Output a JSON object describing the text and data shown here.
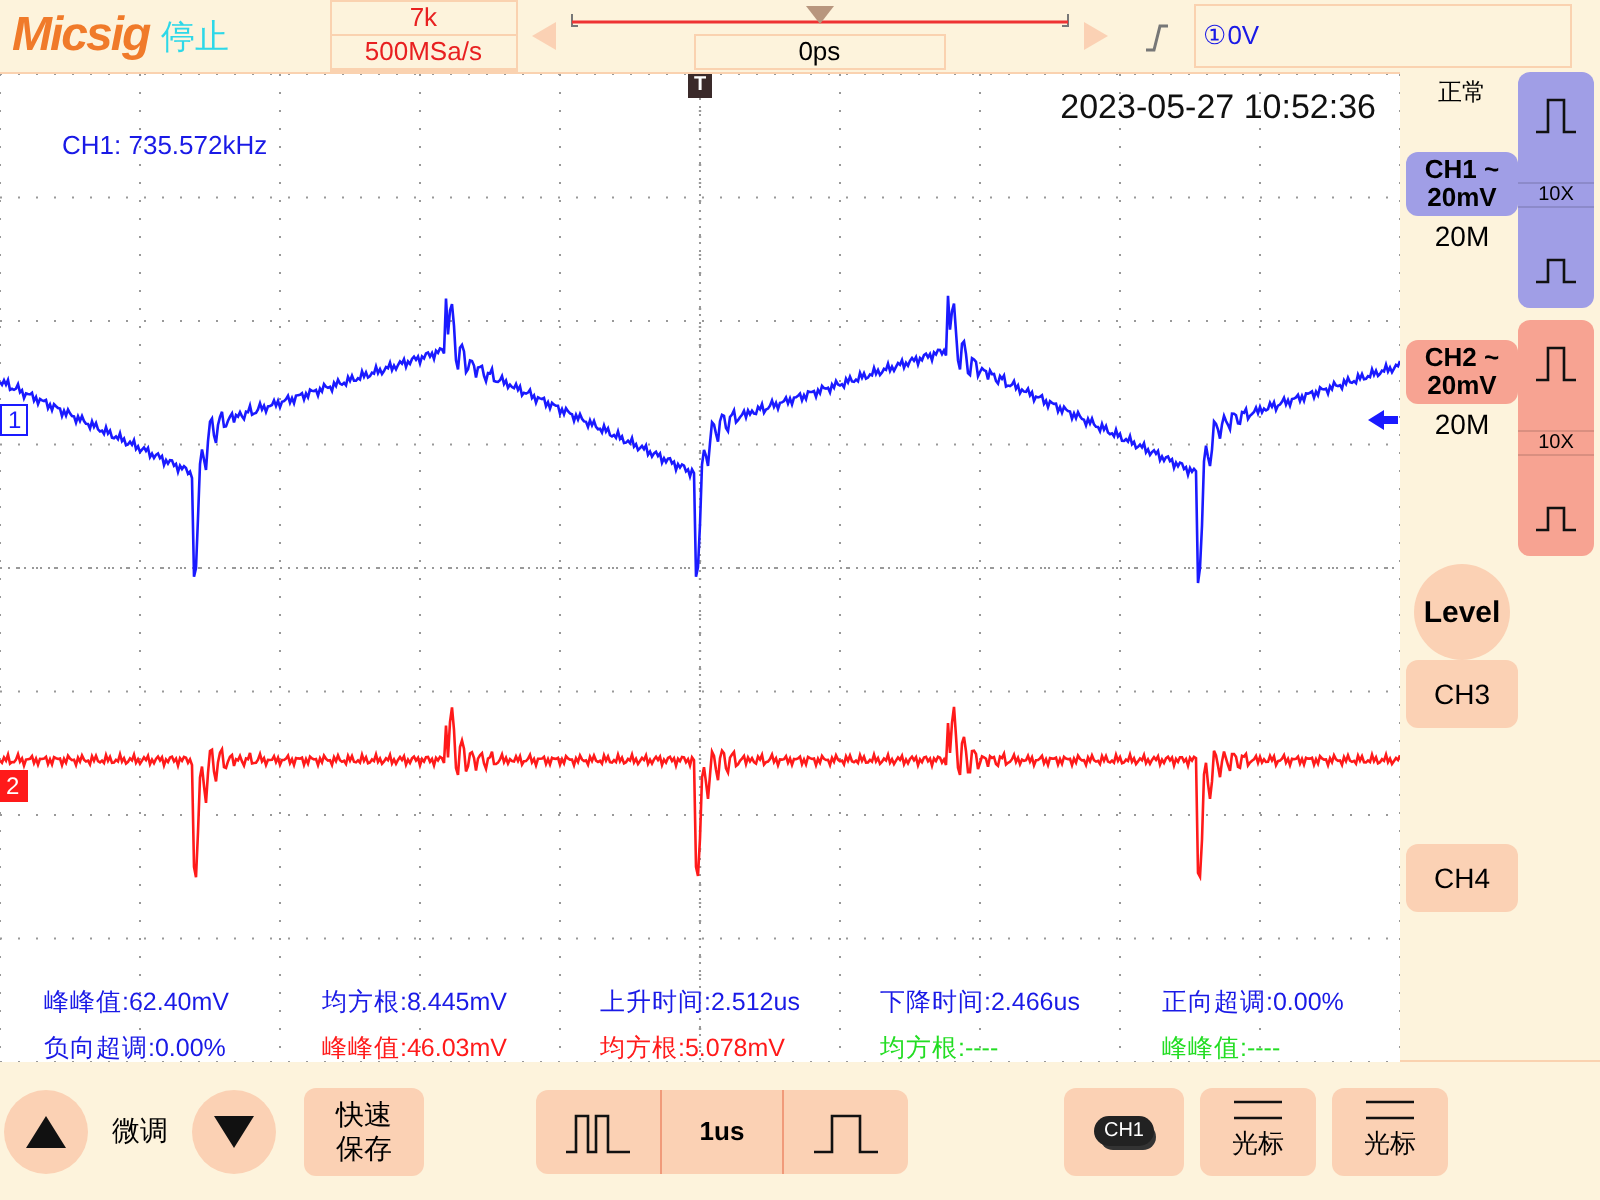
{
  "header": {
    "logo": "Micsig",
    "run_state": "停止",
    "memory_depth": "7k",
    "sample_rate": "500MSa/s",
    "time_offset": "0ps",
    "trigger_level": "①0V"
  },
  "plot": {
    "frequency": "CH1: 735.572kHz",
    "timestamp": "2023-05-27 10:52:36",
    "trigger_marker": "T",
    "traces": [
      {
        "marker": "1",
        "color": "#1a1aff",
        "kind": "sawtooth"
      },
      {
        "marker": "2",
        "color": "#ff1a1a",
        "kind": "flat"
      }
    ]
  },
  "measurements": [
    {
      "text": "峰峰值:62.40mV",
      "color": "#1a1ae6"
    },
    {
      "text": "均方根:8.445mV",
      "color": "#1a1ae6"
    },
    {
      "text": "上升时间:2.512us",
      "color": "#1a1ae6"
    },
    {
      "text": "下降时间:2.466us",
      "color": "#1a1ae6"
    },
    {
      "text": "正向超调:0.00%",
      "color": "#1a1ae6"
    },
    {
      "text": "负向超调:0.00%",
      "color": "#1a1ae6"
    },
    {
      "text": "峰峰值:46.03mV",
      "color": "#ff1a1a"
    },
    {
      "text": "均方根:5.078mV",
      "color": "#ff1a1a"
    },
    {
      "text": "均方根:----",
      "color": "#22dd22"
    },
    {
      "text": "峰峰值:----",
      "color": "#22dd22"
    }
  ],
  "side_panel": {
    "acquire_mode": "正常",
    "channels": [
      {
        "name": "CH1 ~",
        "scale": "20mV",
        "bandwidth": "20M",
        "probe": "10X",
        "color": "#a09ee6"
      },
      {
        "name": "CH2 ~",
        "scale": "20mV",
        "bandwidth": "20M",
        "probe": "10X",
        "color": "#f7a392"
      }
    ],
    "level_button": "Level",
    "extra_channels": [
      "CH3",
      "CH4"
    ]
  },
  "bottom_bar": {
    "fine_label": "微调",
    "quick_save": "快速保存",
    "timebase": "1us",
    "cursor_channel": "CH1",
    "cursor_buttons": [
      "光标",
      "光标"
    ]
  }
}
